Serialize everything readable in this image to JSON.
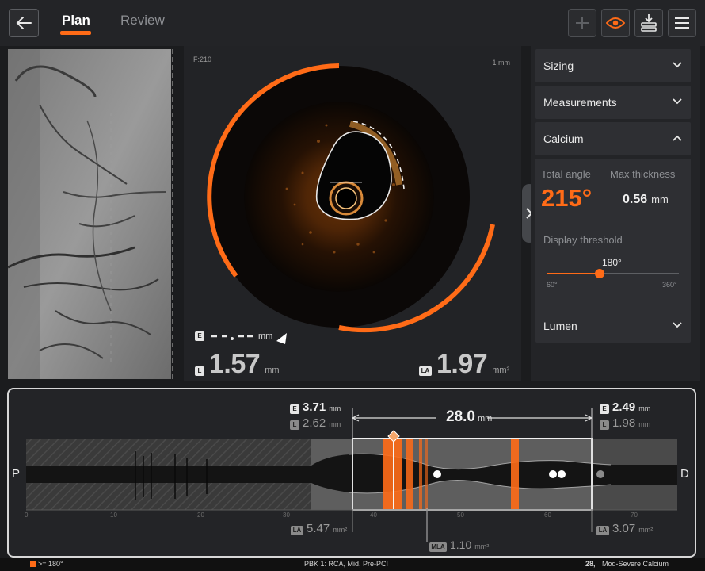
{
  "header": {
    "tabs": [
      {
        "label": "Plan",
        "active": true
      },
      {
        "label": "Review",
        "active": false
      }
    ],
    "tools": [
      "plus-icon",
      "eye-icon",
      "download-stack-icon",
      "menu-icon"
    ],
    "accent_color": "#ff6b17"
  },
  "oct_view": {
    "frame_label": "F:210",
    "scale_label": "1 mm",
    "left_measure": {
      "badge": "E",
      "unit": "mm"
    },
    "diameter": {
      "badge": "L",
      "value": "1.57",
      "unit": "mm"
    },
    "area": {
      "badge": "LA",
      "value": "1.97",
      "unit": "mm²"
    }
  },
  "right_panel": {
    "sections": {
      "sizing": "Sizing",
      "measurements": "Measurements",
      "calcium": "Calcium",
      "lumen": "Lumen"
    },
    "calcium": {
      "total_angle_label": "Total angle",
      "total_angle_value": "215°",
      "max_thickness_label": "Max thickness",
      "max_thickness_value": "0.56",
      "max_thickness_unit": "mm",
      "threshold_label": "Display threshold",
      "threshold_value": "180°",
      "threshold_fraction": 0.4,
      "threshold_min": "60°",
      "threshold_max": "360°"
    }
  },
  "longitudinal": {
    "proximal_label": "P",
    "distal_label": "D",
    "length_value": "28.0",
    "length_unit": "mm",
    "left_ref": {
      "e_badge": "E",
      "e_value": "3.71",
      "e_unit": "mm",
      "l_badge": "L",
      "l_value": "2.62",
      "l_unit": "mm",
      "la_badge": "LA",
      "la_value": "5.47",
      "la_unit": "mm²"
    },
    "right_ref": {
      "e_badge": "E",
      "e_value": "2.49",
      "e_unit": "mm",
      "l_badge": "L",
      "l_value": "1.98",
      "l_unit": "mm",
      "la_badge": "LA",
      "la_value": "3.07",
      "la_unit": "mm²"
    },
    "mla": {
      "badge": "MLA",
      "value": "1.10",
      "unit": "mm²"
    },
    "ticks": [
      "0",
      "10",
      "20",
      "30",
      "40",
      "50",
      "60",
      "70"
    ]
  },
  "footer": {
    "legend": ">= 180°",
    "info": "PBK 1:  RCA,  Mid,  Pre-PCI",
    "count": "28,",
    "calcium_label": "Mod-Severe Calcium"
  }
}
